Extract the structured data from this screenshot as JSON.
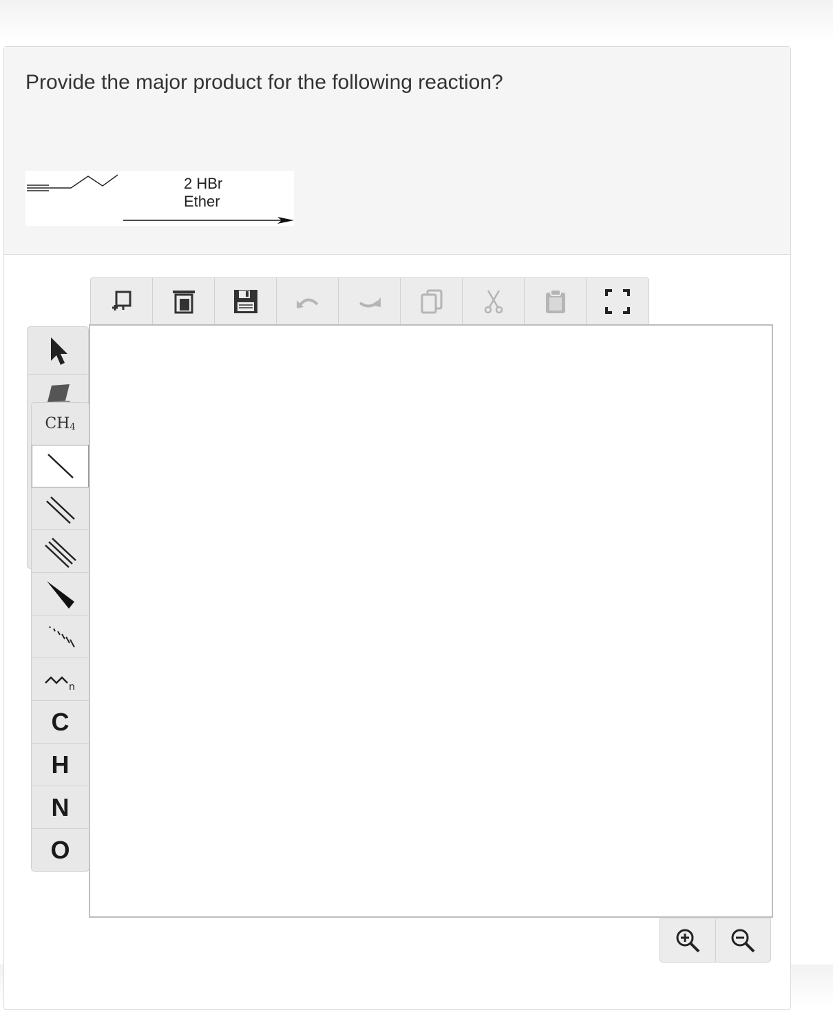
{
  "question": {
    "text": "Provide the major product for the following reaction?"
  },
  "reaction": {
    "reagent_line1": "2 HBr",
    "reagent_line2": "Ether"
  },
  "toolbar": {
    "buttons": [
      {
        "icon": "new-structure-icon",
        "enabled": true
      },
      {
        "icon": "delete-all-icon",
        "enabled": true
      },
      {
        "icon": "save-icon",
        "enabled": true
      },
      {
        "icon": "undo-icon",
        "enabled": false
      },
      {
        "icon": "redo-icon",
        "enabled": false
      },
      {
        "icon": "copy-icon",
        "enabled": false
      },
      {
        "icon": "cut-icon",
        "enabled": false
      },
      {
        "icon": "paste-icon",
        "enabled": false
      },
      {
        "icon": "fullscreen-icon",
        "enabled": true
      }
    ]
  },
  "left_toolbar": {
    "ch4_label": "CH",
    "ch4_sub": "4",
    "active_tool": "single-bond",
    "atoms": [
      "C",
      "H",
      "N",
      "O"
    ]
  },
  "zoom": {
    "zoom_in_icon": "zoom-in-icon",
    "zoom_out_icon": "zoom-out-icon"
  },
  "colors": {
    "panel_bg": "#f5f5f5",
    "toolbar_bg": "#ececec",
    "icon_dark": "#333333",
    "icon_disabled": "#b5b5b5"
  }
}
